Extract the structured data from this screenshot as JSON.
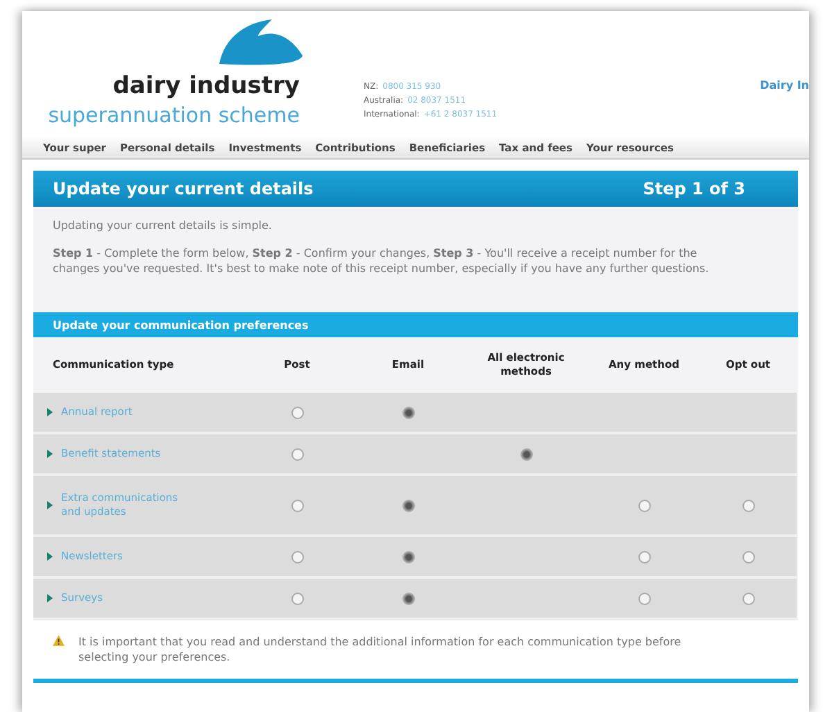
{
  "header": {
    "brand_line_1": "dairy industry",
    "brand_line_2": "superannuation scheme",
    "contacts": [
      {
        "label": "NZ:",
        "value": "0800 315 930"
      },
      {
        "label": "Australia:",
        "value": "02 8037 1511"
      },
      {
        "label": "International:",
        "value": "+61 2 8037 1511"
      }
    ],
    "right_link": "Dairy In"
  },
  "nav": [
    "Your super",
    "Personal details",
    "Investments",
    "Contributions",
    "Beneficiaries",
    "Tax and fees",
    "Your resources"
  ],
  "panel": {
    "title": "Update your current details",
    "step": "Step 1 of 3",
    "intro": "Updating your current details is simple.",
    "steps_text": "**Step 1** - Complete the form below, **Step 2** - Confirm your changes, **Step 3** - You'll receive a receipt number for the changes you've requested. It's best to make note of this receipt number, especially if you have any further questions."
  },
  "preferences": {
    "title": "Update your communication preferences",
    "columns": [
      "Communication type",
      "Post",
      "Email",
      "All electronic methods",
      "Any method",
      "Opt out"
    ],
    "rows": [
      {
        "label": "Annual report",
        "options": [
          {
            "kind": "radio",
            "selected": false
          },
          {
            "kind": "radio",
            "selected": true
          },
          {
            "kind": "empty"
          },
          {
            "kind": "empty"
          },
          {
            "kind": "empty"
          }
        ]
      },
      {
        "label": "Benefit statements",
        "options": [
          {
            "kind": "radio",
            "selected": false
          },
          {
            "kind": "empty"
          },
          {
            "kind": "radio",
            "selected": true
          },
          {
            "kind": "empty"
          },
          {
            "kind": "empty"
          }
        ]
      },
      {
        "label": "Extra communications and updates",
        "options": [
          {
            "kind": "radio",
            "selected": false
          },
          {
            "kind": "radio",
            "selected": true
          },
          {
            "kind": "empty"
          },
          {
            "kind": "radio",
            "selected": false
          },
          {
            "kind": "radio",
            "selected": false
          }
        ]
      },
      {
        "label": "Newsletters",
        "options": [
          {
            "kind": "radio",
            "selected": false
          },
          {
            "kind": "radio",
            "selected": true
          },
          {
            "kind": "empty"
          },
          {
            "kind": "radio",
            "selected": false
          },
          {
            "kind": "radio",
            "selected": false
          }
        ]
      },
      {
        "label": "Surveys",
        "options": [
          {
            "kind": "radio",
            "selected": false
          },
          {
            "kind": "radio",
            "selected": true
          },
          {
            "kind": "empty"
          },
          {
            "kind": "radio",
            "selected": false
          },
          {
            "kind": "radio",
            "selected": false
          }
        ]
      }
    ],
    "note": "It is important that you read and understand the additional information for each communication type before selecting your preferences."
  }
}
